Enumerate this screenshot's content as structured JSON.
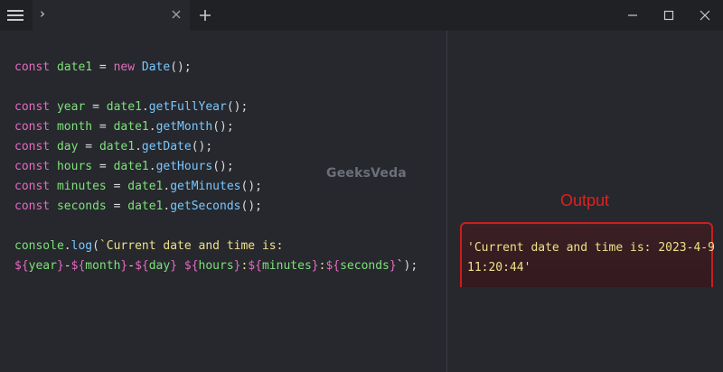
{
  "titlebar": {
    "menu_icon": "hamburger-icon",
    "tab": {
      "title": "›",
      "close_icon": "close-icon"
    },
    "new_tab_icon": "plus-icon",
    "window_controls": {
      "minimize_icon": "minimize-icon",
      "maximize_icon": "maximize-icon",
      "close_icon": "close-icon"
    }
  },
  "code": {
    "lines": [
      [
        {
          "t": "const",
          "c": "kw"
        },
        {
          "t": " ",
          "c": "punc"
        },
        {
          "t": "date1",
          "c": "var"
        },
        {
          "t": " = ",
          "c": "punc"
        },
        {
          "t": "new",
          "c": "kw"
        },
        {
          "t": " ",
          "c": "punc"
        },
        {
          "t": "Date",
          "c": "fn"
        },
        {
          "t": "();",
          "c": "punc"
        }
      ],
      [],
      [
        {
          "t": "const",
          "c": "kw"
        },
        {
          "t": " ",
          "c": "punc"
        },
        {
          "t": "year",
          "c": "var"
        },
        {
          "t": " = ",
          "c": "punc"
        },
        {
          "t": "date1",
          "c": "var"
        },
        {
          "t": ".",
          "c": "punc"
        },
        {
          "t": "getFullYear",
          "c": "fn"
        },
        {
          "t": "();",
          "c": "punc"
        }
      ],
      [
        {
          "t": "const",
          "c": "kw"
        },
        {
          "t": " ",
          "c": "punc"
        },
        {
          "t": "month",
          "c": "var"
        },
        {
          "t": " = ",
          "c": "punc"
        },
        {
          "t": "date1",
          "c": "var"
        },
        {
          "t": ".",
          "c": "punc"
        },
        {
          "t": "getMonth",
          "c": "fn"
        },
        {
          "t": "();",
          "c": "punc"
        }
      ],
      [
        {
          "t": "const",
          "c": "kw"
        },
        {
          "t": " ",
          "c": "punc"
        },
        {
          "t": "day",
          "c": "var"
        },
        {
          "t": " = ",
          "c": "punc"
        },
        {
          "t": "date1",
          "c": "var"
        },
        {
          "t": ".",
          "c": "punc"
        },
        {
          "t": "getDate",
          "c": "fn"
        },
        {
          "t": "();",
          "c": "punc"
        }
      ],
      [
        {
          "t": "const",
          "c": "kw"
        },
        {
          "t": " ",
          "c": "punc"
        },
        {
          "t": "hours",
          "c": "var"
        },
        {
          "t": " = ",
          "c": "punc"
        },
        {
          "t": "date1",
          "c": "var"
        },
        {
          "t": ".",
          "c": "punc"
        },
        {
          "t": "getHours",
          "c": "fn"
        },
        {
          "t": "();",
          "c": "punc"
        }
      ],
      [
        {
          "t": "const",
          "c": "kw"
        },
        {
          "t": " ",
          "c": "punc"
        },
        {
          "t": "minutes",
          "c": "var"
        },
        {
          "t": " = ",
          "c": "punc"
        },
        {
          "t": "date1",
          "c": "var"
        },
        {
          "t": ".",
          "c": "punc"
        },
        {
          "t": "getMinutes",
          "c": "fn"
        },
        {
          "t": "();",
          "c": "punc"
        }
      ],
      [
        {
          "t": "const",
          "c": "kw"
        },
        {
          "t": " ",
          "c": "punc"
        },
        {
          "t": "seconds",
          "c": "var"
        },
        {
          "t": " = ",
          "c": "punc"
        },
        {
          "t": "date1",
          "c": "var"
        },
        {
          "t": ".",
          "c": "punc"
        },
        {
          "t": "getSeconds",
          "c": "fn"
        },
        {
          "t": "();",
          "c": "punc"
        }
      ],
      [],
      [
        {
          "t": "console",
          "c": "var"
        },
        {
          "t": ".",
          "c": "punc"
        },
        {
          "t": "log",
          "c": "fn"
        },
        {
          "t": "(",
          "c": "punc"
        },
        {
          "t": "`Current date and time is:",
          "c": "str"
        }
      ],
      [
        {
          "t": "${",
          "c": "interp"
        },
        {
          "t": "year",
          "c": "var"
        },
        {
          "t": "}",
          "c": "interp"
        },
        {
          "t": "-",
          "c": "str"
        },
        {
          "t": "${",
          "c": "interp"
        },
        {
          "t": "month",
          "c": "var"
        },
        {
          "t": "}",
          "c": "interp"
        },
        {
          "t": "-",
          "c": "str"
        },
        {
          "t": "${",
          "c": "interp"
        },
        {
          "t": "day",
          "c": "var"
        },
        {
          "t": "}",
          "c": "interp"
        },
        {
          "t": " ",
          "c": "str"
        },
        {
          "t": "${",
          "c": "interp"
        },
        {
          "t": "hours",
          "c": "var"
        },
        {
          "t": "}",
          "c": "interp"
        },
        {
          "t": ":",
          "c": "str"
        },
        {
          "t": "${",
          "c": "interp"
        },
        {
          "t": "minutes",
          "c": "var"
        },
        {
          "t": "}",
          "c": "interp"
        },
        {
          "t": ":",
          "c": "str"
        },
        {
          "t": "${",
          "c": "interp"
        },
        {
          "t": "seconds",
          "c": "var"
        },
        {
          "t": "}",
          "c": "interp"
        },
        {
          "t": "`",
          "c": "str"
        },
        {
          "t": ");",
          "c": "punc"
        }
      ]
    ]
  },
  "watermark": "GeeksVeda",
  "output": {
    "label": "Output",
    "lines": [
      "'Current date and time is: 2023-4-9",
      "11:20:44'"
    ]
  },
  "colors": {
    "background": "#26282d",
    "keyword": "#e56bc0",
    "variable": "#7fe07a",
    "function": "#79c7ff",
    "string": "#f0e08a",
    "output_border": "#c81f1f"
  }
}
